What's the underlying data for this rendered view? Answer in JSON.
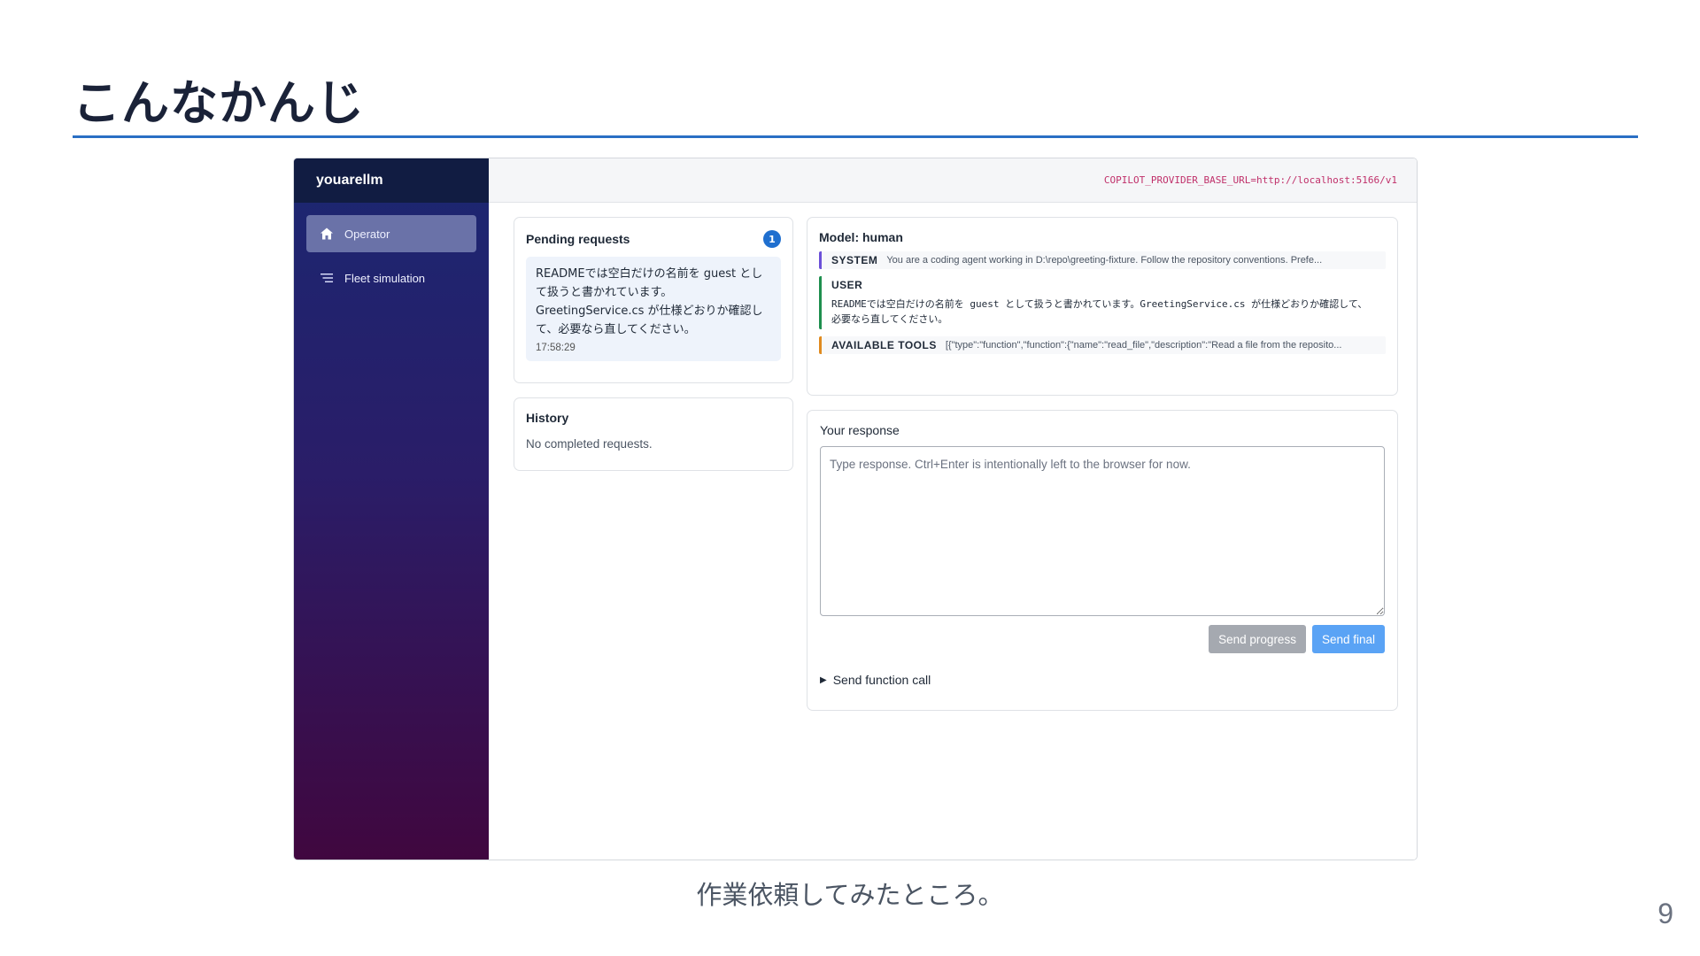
{
  "slide": {
    "title": "こんなかんじ",
    "caption": "作業依頼してみたところ。",
    "page_number": "9"
  },
  "app": {
    "brand": "youarellm",
    "nav": [
      {
        "label": "Operator",
        "icon": "home-icon",
        "active": true
      },
      {
        "label": "Fleet simulation",
        "icon": "list-icon",
        "active": false
      }
    ],
    "env_text": "COPILOT_PROVIDER_BASE_URL=http://localhost:5166/v1"
  },
  "pending": {
    "title": "Pending requests",
    "count": "1",
    "item": {
      "text": "READMEでは空白だけの名前を guest として扱うと書かれています。GreetingService.cs が仕様どおりか確認して、必要なら直してください。",
      "time": "17:58:29"
    }
  },
  "history": {
    "title": "History",
    "empty": "No completed requests."
  },
  "model": {
    "title": "Model: human",
    "system_role": "SYSTEM",
    "system_preview": "You are a coding agent working in D:\\repo\\greeting-fixture. Follow the repository conventions. Prefe...",
    "user_role": "USER",
    "user_text": "READMEでは空白だけの名前を guest として扱うと書かれています。GreetingService.cs が仕様どおりか確認して、必要なら直してください。",
    "tools_role": "AVAILABLE TOOLS",
    "tools_preview": "[{\"type\":\"function\",\"function\":{\"name\":\"read_file\",\"description\":\"Read a file from the reposito..."
  },
  "response": {
    "label": "Your response",
    "placeholder": "Type response. Ctrl+Enter is intentionally left to the browser for now.",
    "value": "",
    "send_progress": "Send progress",
    "send_final": "Send final",
    "function_call": "Send function call"
  },
  "colors": {
    "accent": "#2a6fc4",
    "sidebar_top": "#1b2772",
    "sidebar_bottom": "#40073f",
    "badge": "#1f6fcf",
    "system_border": "#6b4fd8",
    "user_border": "#1e8f4e",
    "tools_border": "#e08a1e",
    "send_final": "#5aa3f5"
  }
}
